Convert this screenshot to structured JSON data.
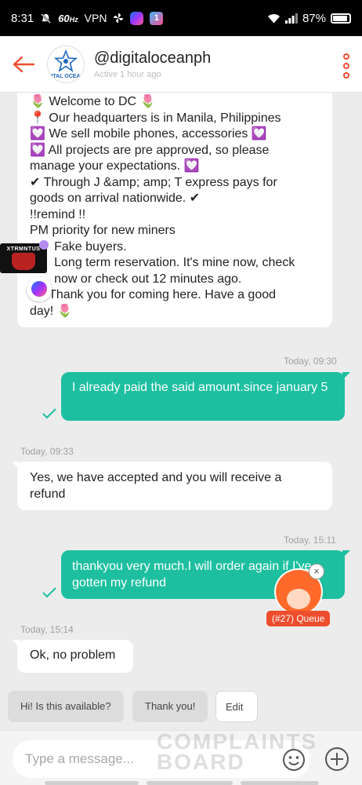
{
  "status_bar": {
    "time": "8:31",
    "refresh": "60",
    "refresh_unit": "Hz",
    "vpn": "VPN",
    "app_badge_text": "1",
    "battery": "87%"
  },
  "header": {
    "shop_name": "@digitaloceanph",
    "active_status": "Active 1 hour ago",
    "avatar_caption": "ITAL OCEA"
  },
  "floating": {
    "app_label": "XTRMNTUS",
    "queue_label": "(#27) Queue",
    "queue_close": "×"
  },
  "messages": {
    "welcome_lines": [
      {
        "emoji": "🌷",
        "text": " Welcome to DC ",
        "emoji_after": "🌷"
      },
      {
        "emoji": "📍",
        "text": " Our headquarters is in Manila, Philippines",
        "emoji_after": ""
      },
      {
        "emoji": "💟",
        "text": " We sell mobile phones, accessories ",
        "emoji_after": "💟"
      },
      {
        "emoji": "💟",
        "text": " All projects are pre approved, so please",
        "emoji_after": ""
      },
      {
        "emoji": "",
        "text": "manage your expectations. ",
        "emoji_after": "💟"
      },
      {
        "emoji": "✔",
        "text": " Through J &amp; amp; T express pays for",
        "emoji_after": ""
      },
      {
        "emoji": "",
        "text": "goods on arrival nationwide. ",
        "emoji_after": "✔"
      },
      {
        "emoji": "",
        "text": "!!remind !!",
        "emoji_after": ""
      },
      {
        "emoji": "",
        "text": "PM priority for new miners",
        "emoji_after": ""
      },
      {
        "emoji": "",
        "text": "       Fake buyers.",
        "emoji_after": ""
      },
      {
        "emoji": "",
        "text": "       Long term reservation. It's mine now, check",
        "emoji_after": ""
      },
      {
        "emoji": "",
        "text": "       now or check out 12 minutes ago.",
        "emoji_after": ""
      },
      {
        "emoji": "🌷",
        "text": " Thank you for coming here. Have a good",
        "emoji_after": ""
      },
      {
        "emoji": "",
        "text": "day! ",
        "emoji_after": "🌷"
      }
    ],
    "ts1": "Today, 09:30",
    "out1": "I already paid the said amount.since january 5",
    "ts2": "Today, 09:33",
    "in1": "Yes, we have accepted and you will receive a refund",
    "ts3": "Today, 15:11",
    "out2": "thankyou very much.I will order again if I've gotten my refund",
    "ts4": "Today, 15:14",
    "in2": "Ok, no problem"
  },
  "quick_replies": [
    "Hi! Is this available?",
    "Thank you!",
    "Edit"
  ],
  "composer": {
    "placeholder": "Type a message...",
    "watermark_1": "COMPLAINTS",
    "watermark_2": "BOARD"
  },
  "colors": {
    "accent": "#ee4d2d",
    "outgoing_bubble": "#1dbfa0",
    "background": "#ececec"
  }
}
